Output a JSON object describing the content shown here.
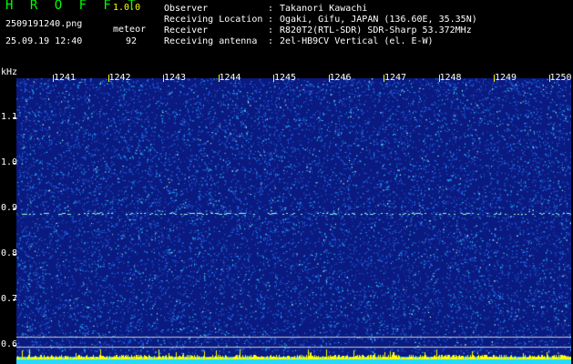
{
  "header": {
    "app_name": "H R O F F T",
    "version": "1.0.0",
    "filename": "2509191240.png",
    "mode": "meteor",
    "datetime": "25.09.19 12:40",
    "count": "92"
  },
  "station": {
    "observer_label": "Observer",
    "observer": "Takanori Kawachi",
    "location_label": "Receiving Location",
    "location": "Ogaki, Gifu, JAPAN (136.60E, 35.35N)",
    "receiver_label": "Receiver",
    "receiver": "R820T2(RTL-SDR) SDR-Sharp 53.372MHz",
    "antenna_label": "Receiving antenna",
    "antenna": "2el-HB9CV Vertical (el. E-W)",
    "sep": ":"
  },
  "spectrogram": {
    "y_unit": "kHz",
    "y_ticks": [
      "1.1",
      "1.0",
      "0.9",
      "0.8",
      "0.7",
      "0.6"
    ],
    "x_ticks": [
      "1241",
      "1242",
      "1243",
      "1244",
      "1245",
      "1246",
      "1247",
      "1248",
      "1249",
      "1250"
    ],
    "echo_freq_khz": 0.9,
    "colors": {
      "background": "#0a1a80",
      "noise_light": "#2a7fff",
      "noise_cyan": "#25d9ff",
      "echo": "#9bffe0",
      "tick": "#ffff00",
      "baseline": "#ffffff"
    }
  }
}
